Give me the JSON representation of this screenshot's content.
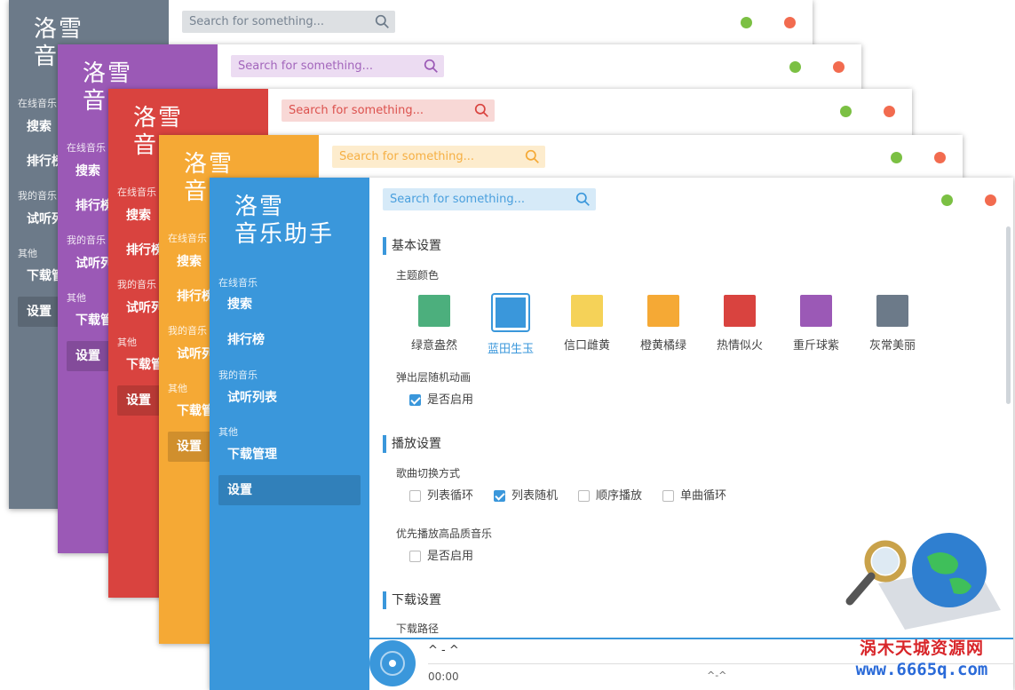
{
  "logo": "洛雪\n音乐助手",
  "logo_short": "洛雪\n音",
  "search_placeholder": "Search for something...",
  "sidebar": {
    "online_music": "在线音乐",
    "search": "搜索",
    "ranking": "排行榜",
    "my_music": "我的音乐",
    "trial_list": "试听列表",
    "other": "其他",
    "download_manage": "下载管理",
    "settings": "设置"
  },
  "sidebar_truncated": {
    "ranking": "排行榜",
    "trial_list": "试听列",
    "download_manage": "下载管"
  },
  "theme_colors": {
    "gray": "#6c7a89",
    "purple": "#9b59b6",
    "red": "#d9433f",
    "orange": "#f5a935",
    "blue": "#3a97db"
  },
  "settings": {
    "basic_title": "基本设置",
    "theme_label": "主题颜色",
    "themes": [
      {
        "name": "绿意盎然",
        "color": "#4caf7d"
      },
      {
        "name": "蓝田生玉",
        "color": "#3a97db",
        "selected": true
      },
      {
        "name": "信口雌黄",
        "color": "#f5d258"
      },
      {
        "name": "橙黄橘绿",
        "color": "#f5a935"
      },
      {
        "name": "热情似火",
        "color": "#d9433f"
      },
      {
        "name": "重斤球紫",
        "color": "#9b59b6"
      },
      {
        "name": "灰常美丽",
        "color": "#6c7a89"
      }
    ],
    "popup_label": "弹出层随机动画",
    "enable": "是否启用",
    "play_title": "播放设置",
    "switch_label": "歌曲切换方式",
    "switch_modes": [
      "列表循环",
      "列表随机",
      "顺序播放",
      "单曲循环"
    ],
    "hq_label": "优先播放高品质音乐",
    "download_title": "下载设置",
    "download_path": "下载路径"
  },
  "player": {
    "song": "^ - ^",
    "time": "00:00",
    "total": "^-^"
  },
  "watermark": {
    "text": "涡木天城资源网",
    "url": "www.6665q.com"
  }
}
